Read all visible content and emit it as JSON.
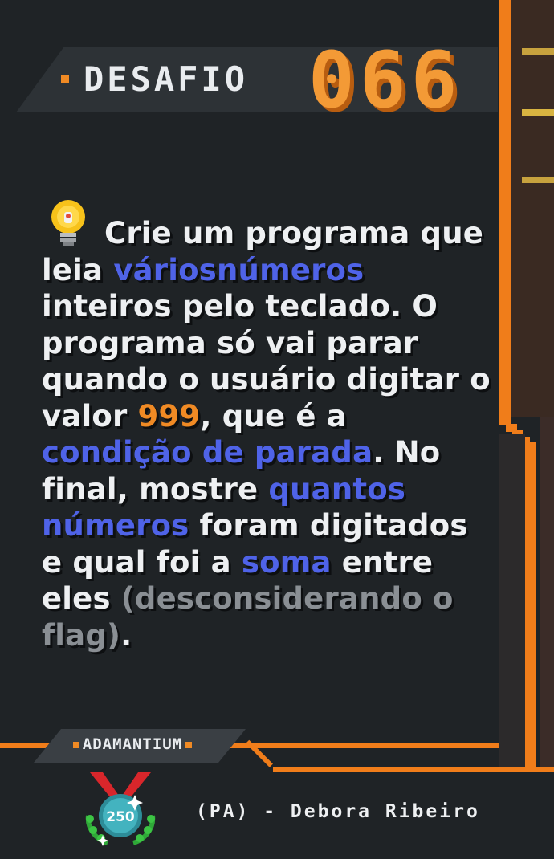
{
  "header": {
    "label": "DESAFIO",
    "number": "066"
  },
  "challenge": {
    "segments": [
      {
        "text": "Crie um programa",
        "style": "normal",
        "lead": true
      },
      {
        "text": " que leia ",
        "style": "normal",
        "br": true
      },
      {
        "text": "vários",
        "style": "blue"
      },
      {
        "text": "números",
        "style": "blue",
        "br": true
      },
      {
        "text": " inteiros pelo teclado. O programa só vai parar quando o usuário digitar o valor ",
        "style": "normal"
      },
      {
        "text": "999",
        "style": "orange"
      },
      {
        "text": ", que é a ",
        "style": "normal"
      },
      {
        "text": "condição de parada",
        "style": "blue"
      },
      {
        "text": ". No final, mostre ",
        "style": "normal"
      },
      {
        "text": "quantos números",
        "style": "blue"
      },
      {
        "text": " foram digitados e qual foi a ",
        "style": "normal"
      },
      {
        "text": "soma",
        "style": "blue"
      },
      {
        "text": " entre eles ",
        "style": "normal"
      },
      {
        "text": "(desconsiderando o flag)",
        "style": "muted"
      },
      {
        "text": ".",
        "style": "normal"
      }
    ]
  },
  "rank": {
    "label": "ADAMANTIUM",
    "badge_value": "250"
  },
  "author": {
    "text": "(PA) - Debora Ribeiro"
  },
  "colors": {
    "accent": "#f07d1a",
    "highlight": "#4f63e8",
    "background": "#1f2326"
  }
}
